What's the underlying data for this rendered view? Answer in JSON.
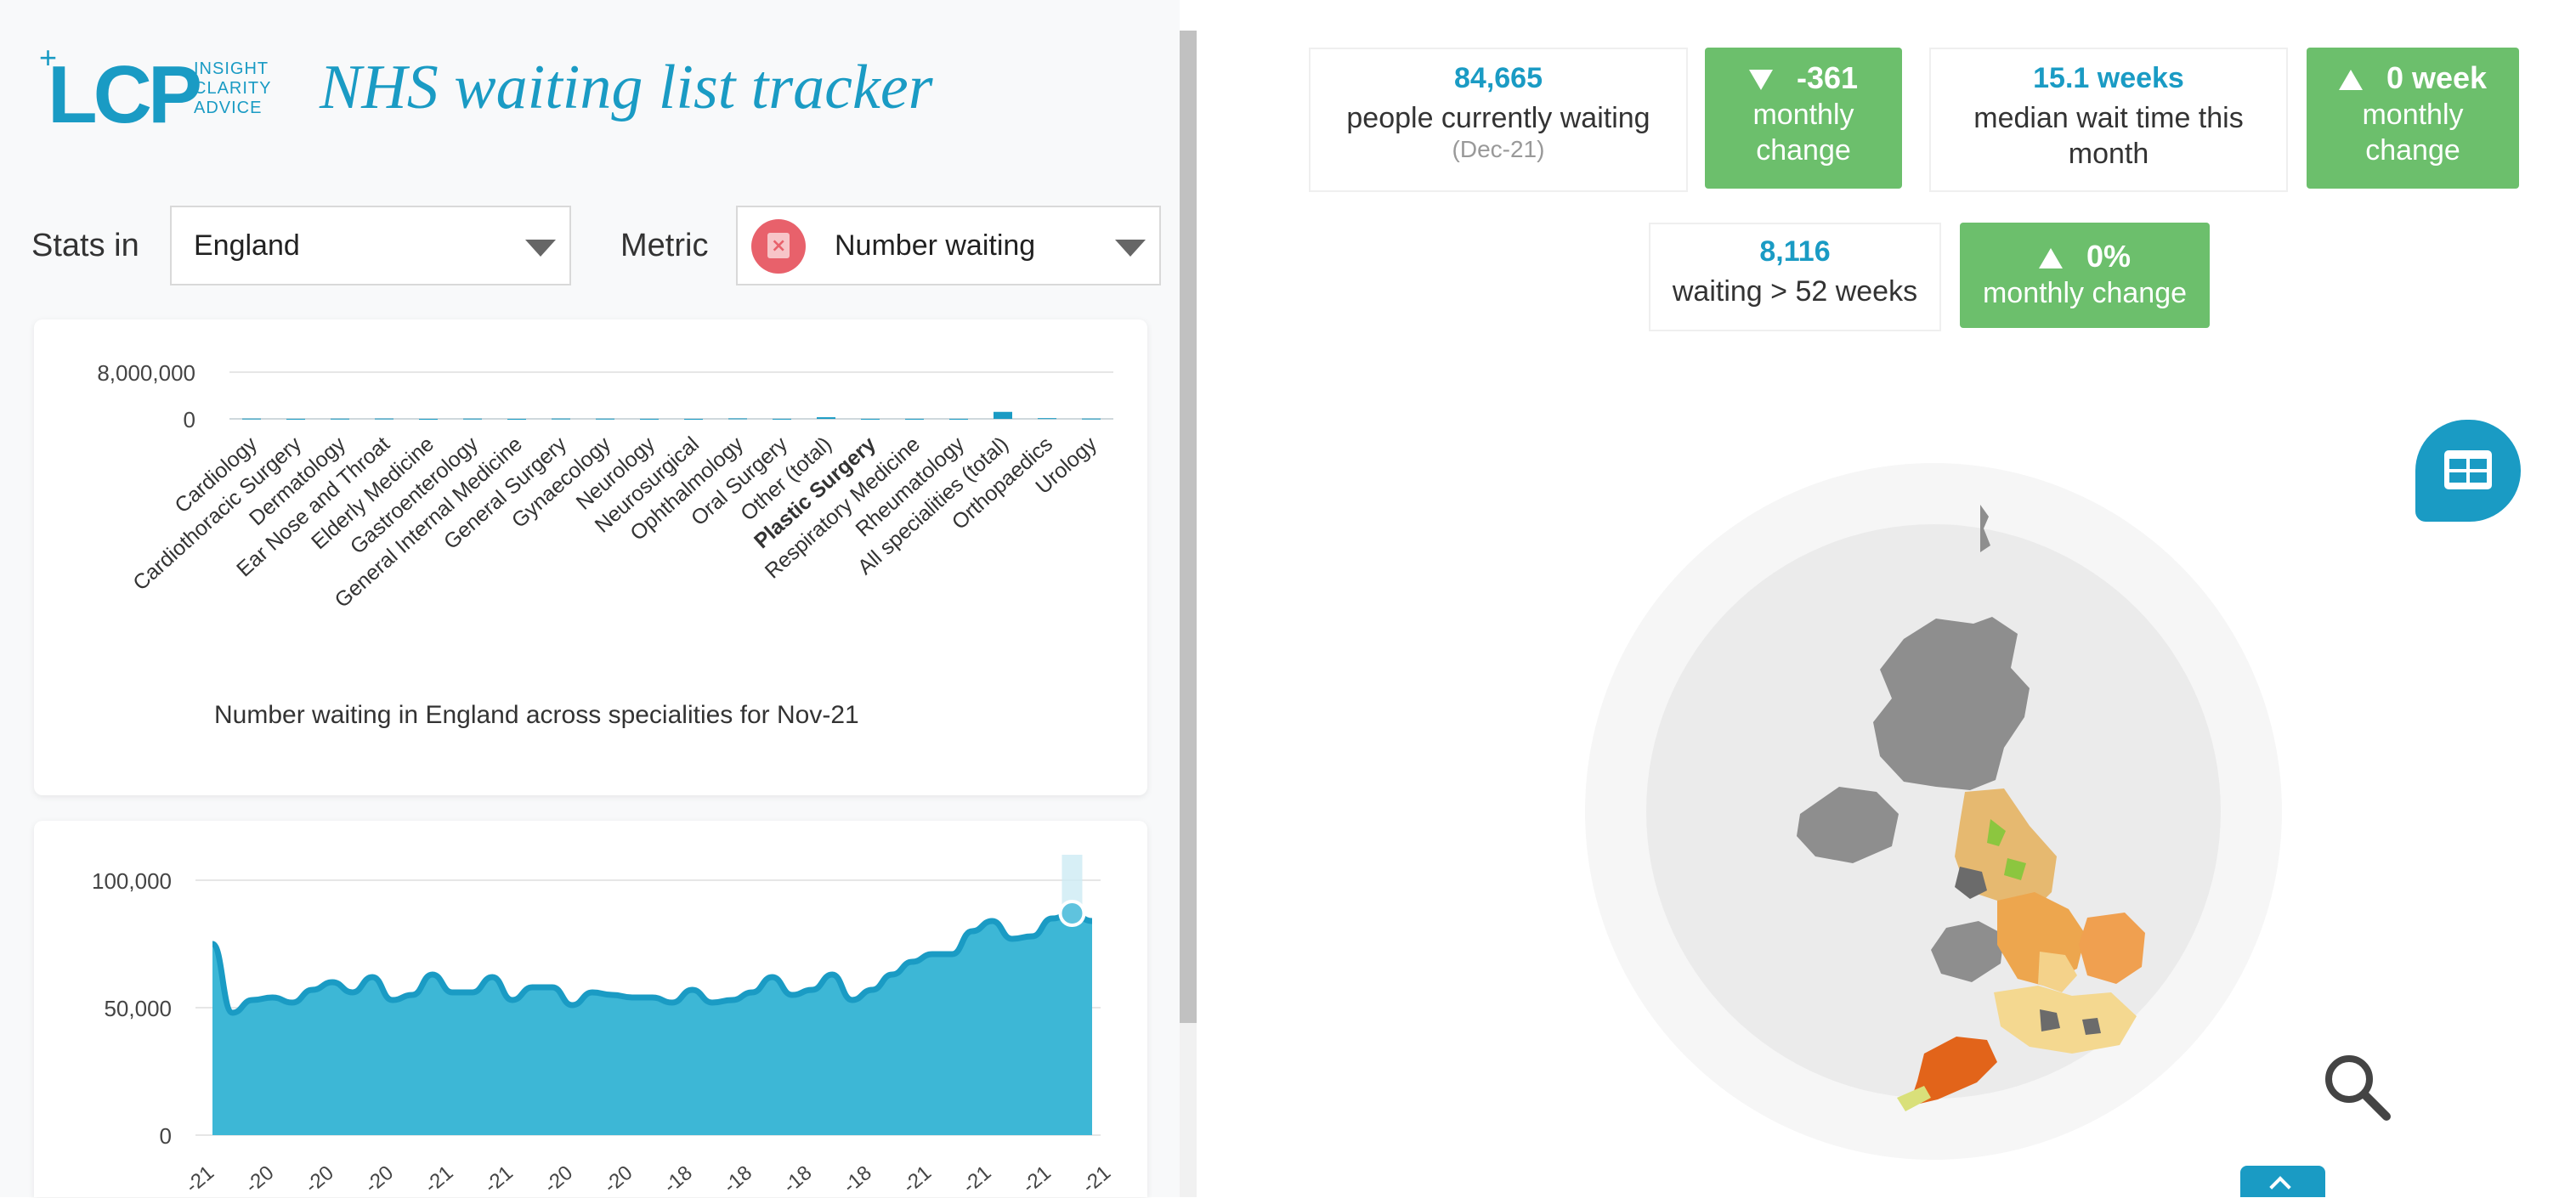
{
  "app": {
    "logo_text": "LCP",
    "logo_plus": "+",
    "logo_tagline": [
      "INSIGHT",
      "CLARITY",
      "ADVICE"
    ],
    "title": "NHS waiting list tracker"
  },
  "filters": {
    "stats_in_label": "Stats in",
    "stats_in_value": "England",
    "metric_label": "Metric",
    "metric_value": "Number waiting",
    "metric_icon": "calendar-x-icon"
  },
  "chart_data": [
    {
      "type": "bar",
      "title": "Number waiting in England across specialities for Nov-21",
      "ylabel": "",
      "ylim": [
        0,
        8000000
      ],
      "y_ticks": [
        "8,000,000",
        "0"
      ],
      "categories": [
        "Cardiology",
        "Cardiothoracic Surgery",
        "Dermatology",
        "Ear Nose and Throat",
        "Elderly Medicine",
        "Gastroenterology",
        "General Internal Medicine",
        "General Surgery",
        "Gynaecology",
        "Neurology",
        "Neurosurgical",
        "Ophthalmology",
        "Oral Surgery",
        "Other (total)",
        "Plastic Surgery",
        "Respiratory Medicine",
        "Rheumatology",
        "All specialities (total)",
        "Orthopaedics",
        "Urology"
      ],
      "highlight_category": "Plastic Surgery",
      "values": [
        50000,
        10000,
        40000,
        60000,
        2000,
        45000,
        1000,
        55000,
        40000,
        12000,
        3000,
        80000,
        15000,
        280000,
        10000,
        12000,
        10000,
        1200000,
        120000,
        50000
      ],
      "color": "#1a9bc4"
    },
    {
      "type": "area",
      "title": "",
      "ylim": [
        0,
        100000
      ],
      "y_ticks": [
        "100,000",
        "50,000",
        "0"
      ],
      "x_tick_labels": [
        "-21",
        "-20",
        "-20",
        "-20",
        "-21",
        "-21",
        "-20",
        "-20",
        "-18",
        "-18",
        "-18",
        "-18",
        "-21",
        "-21",
        "-21",
        "-21"
      ],
      "values": [
        75000,
        48000,
        53000,
        54000,
        52000,
        57000,
        60000,
        56000,
        62000,
        53000,
        55000,
        63000,
        56000,
        56000,
        62000,
        53000,
        58000,
        58000,
        51000,
        56000,
        55000,
        54000,
        54000,
        52000,
        57000,
        52000,
        53000,
        56000,
        62000,
        55000,
        57000,
        63000,
        53000,
        57000,
        63000,
        68000,
        71000,
        71000,
        80000,
        84000,
        77000,
        78000,
        85000,
        87000,
        84000
      ],
      "highlight_index": 43,
      "color": "#3db7d6",
      "line_color": "#1a9bc4"
    }
  ],
  "stats": {
    "people_waiting_value": "84,665",
    "people_waiting_label": "people currently waiting",
    "people_waiting_date": "(Dec-21)",
    "people_change_value": "-361",
    "people_change_label": "monthly change",
    "median_wait_value": "15.1 weeks",
    "median_wait_label": "median wait time this month",
    "median_change_value": "0 week",
    "median_change_label": "monthly change",
    "long_wait_value": "8,116",
    "long_wait_label": "waiting > 52 weeks",
    "long_change_value": "0%",
    "long_change_label": "monthly change"
  },
  "colors": {
    "brand": "#1a9bc4",
    "positive": "#6cbf6c",
    "map_gray": "#8e8e8e"
  }
}
